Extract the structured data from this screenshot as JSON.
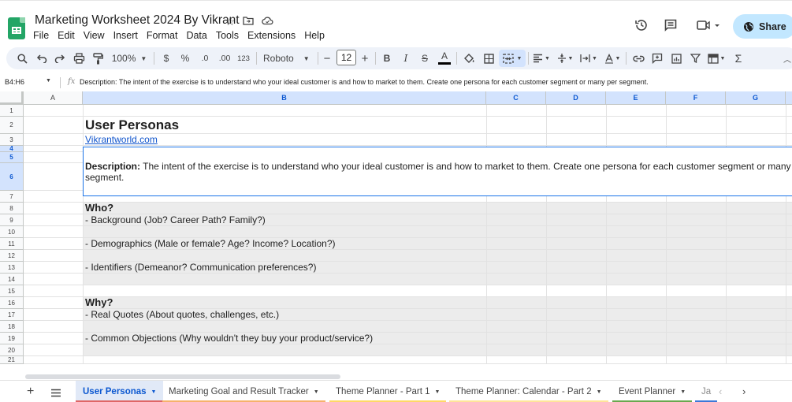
{
  "app": {
    "title": "Marketing Worksheet 2024 By Vikrant",
    "menu": [
      "File",
      "Edit",
      "View",
      "Insert",
      "Format",
      "Data",
      "Tools",
      "Extensions",
      "Help"
    ],
    "share_label": "Share",
    "colors": {
      "accent": "#1a73e8",
      "share_bg": "#c2e7ff",
      "sheets_green": "#23a566",
      "selection": "#d3e3fd"
    }
  },
  "toolbar": {
    "zoom": "100%",
    "currency": "$",
    "percent": "%",
    "dec_decrease": ".0",
    "dec_increase": ".00",
    "number_format": "123",
    "font": "Roboto",
    "font_size": "12",
    "minus": "−",
    "plus": "+",
    "bold": "B",
    "italic": "I",
    "strike": "S",
    "text_color": "A"
  },
  "formula_bar": {
    "name_box": "B4:H6",
    "fx": "fx",
    "content": "Description: The intent of the exercise is to understand who your ideal customer is and how to market to them. Create one persona for each customer segment or many per segment."
  },
  "columns": [
    "A",
    "B",
    "C",
    "D",
    "E",
    "F",
    "G"
  ],
  "rows": [
    "1",
    "2",
    "3",
    "4",
    "5",
    "6",
    "7",
    "8",
    "9",
    "10",
    "11",
    "12",
    "13",
    "14",
    "15",
    "16",
    "17",
    "18",
    "19",
    "20",
    "21"
  ],
  "cells": {
    "r2": "User Personas",
    "r3": "Vikrantworld.com",
    "r5_label": "Description:",
    "r5_text": " The intent of the exercise is to understand who your ideal customer is and how to market to them. Create one persona for each customer segment or many p",
    "r6_text": "segment.",
    "r8": "Who?",
    "r9": "- Background (Job? Career Path? Family?)",
    "r11": "- Demographics (Male or female? Age? Income? Location?)",
    "r13": "- Identifiers (Demeanor? Communication preferences?)",
    "r16": "Why?",
    "r17": "- Real Quotes (About quotes, challenges, etc.)",
    "r19": "- Common Objections (Why wouldn't they buy your product/service?)"
  },
  "sheet_tabs": [
    {
      "label": "User Personas",
      "active": true
    },
    {
      "label": "Marketing Goal and Result Tracker"
    },
    {
      "label": "Theme Planner - Part 1"
    },
    {
      "label": "Theme Planner: Calendar - Part 2"
    },
    {
      "label": "Event Planner"
    },
    {
      "label": "Ja"
    }
  ],
  "icons": [
    "sheets-logo-icon",
    "star-icon",
    "move-folder-icon",
    "cloud-icon",
    "history-icon",
    "comment-icon",
    "video-icon",
    "globe-icon",
    "search-icon",
    "undo-icon",
    "redo-icon",
    "print-icon",
    "paint-format-icon",
    "fill-color-icon",
    "borders-icon",
    "merge-icon",
    "align-icon",
    "valign-icon",
    "wrap-icon",
    "rotate-icon",
    "link-icon",
    "add-comment-icon",
    "chart-icon",
    "filter-icon",
    "table-icon",
    "sigma-icon",
    "collapse-icon",
    "add-sheet-icon",
    "all-sheets-icon"
  ]
}
